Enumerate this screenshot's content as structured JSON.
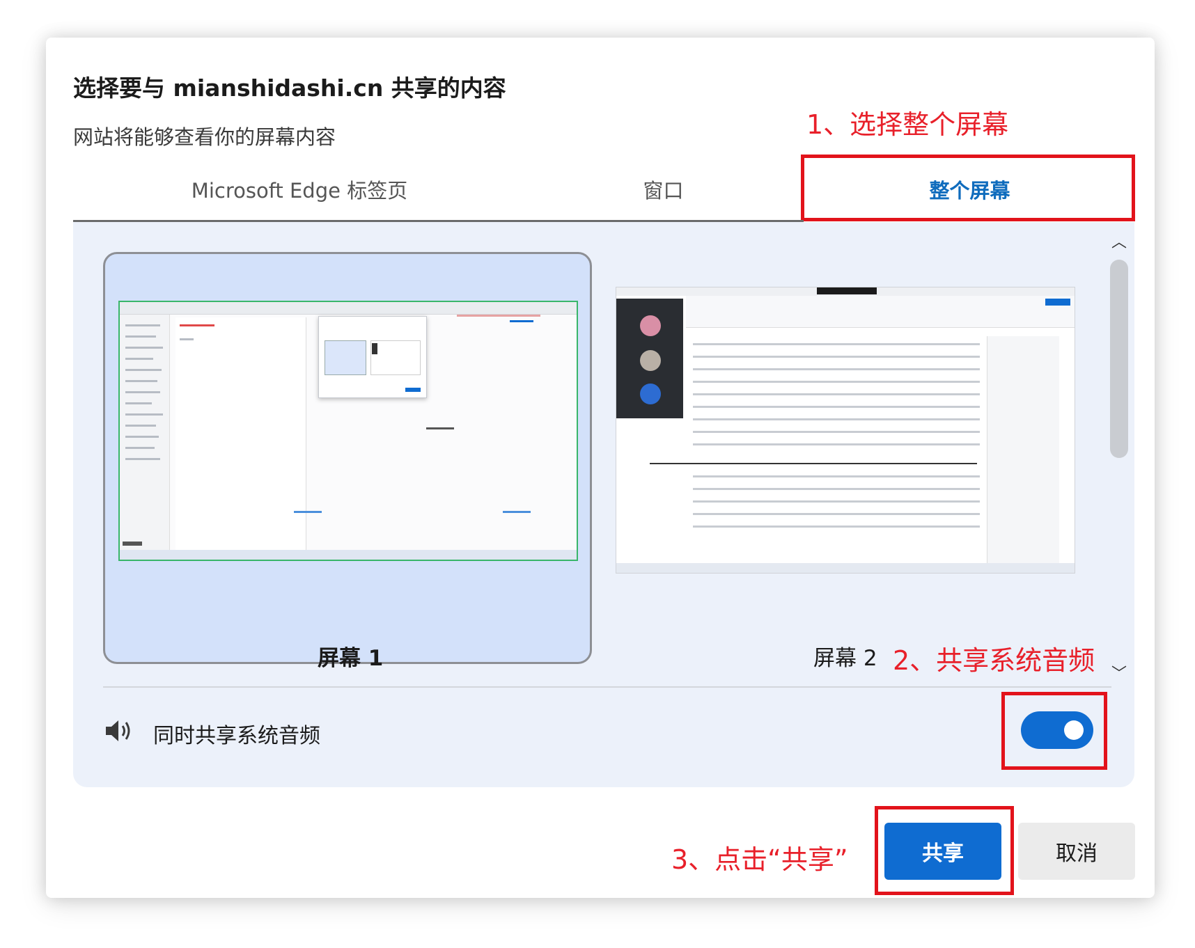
{
  "dialog": {
    "title": "选择要与 mianshidashi.cn 共享的内容",
    "subtitle": "网站将能够查看你的屏幕内容"
  },
  "tabs": [
    {
      "label": "Microsoft Edge 标签页",
      "active": false
    },
    {
      "label": "窗口",
      "active": false
    },
    {
      "label": "整个屏幕",
      "active": true
    }
  ],
  "screens": [
    {
      "label": "屏幕 1",
      "selected": true
    },
    {
      "label": "屏幕 2",
      "selected": false
    }
  ],
  "audio": {
    "label": "同时共享系统音频",
    "enabled": true,
    "icon": "speaker-icon"
  },
  "buttons": {
    "share": "共享",
    "cancel": "取消"
  },
  "annotations": {
    "step1": "1、选择整个屏幕",
    "step2": "2、共享系统音频",
    "step3": "3、点击“共享”"
  },
  "colors": {
    "accent": "#0f6cd1",
    "annotation": "#e8202a",
    "panel": "#ecf1fa",
    "selected_card": "#d3e1fa"
  }
}
